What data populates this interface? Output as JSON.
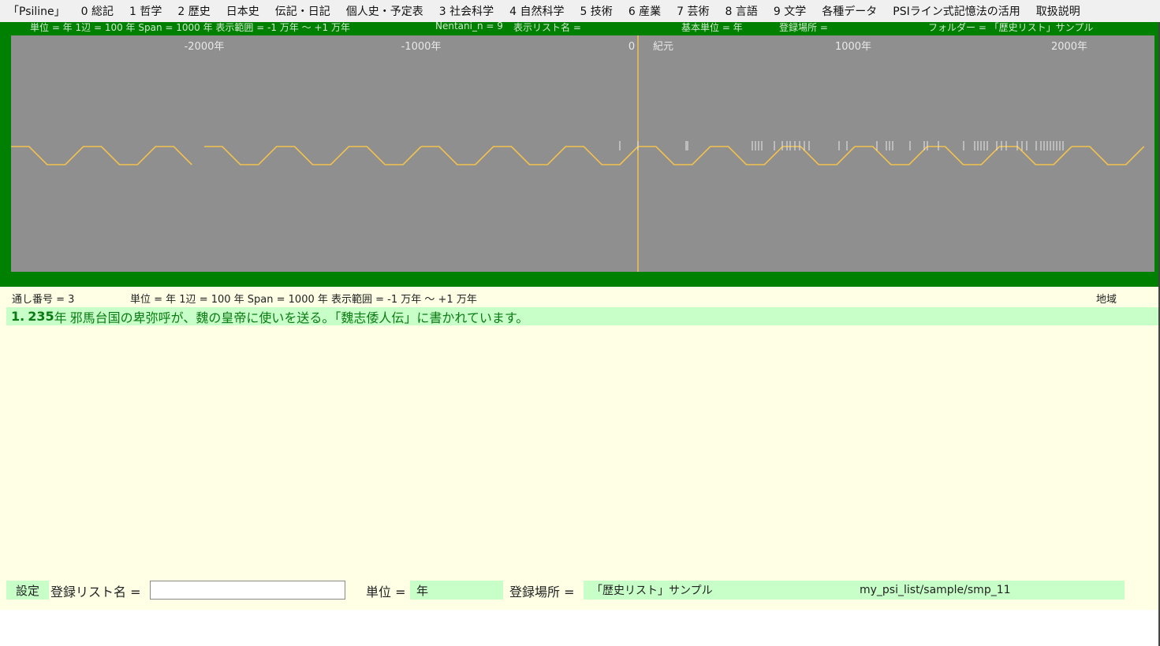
{
  "menu": [
    "「Psiline」",
    "0 総記",
    "1 哲学",
    "2 歴史",
    "日本史",
    "伝記・日記",
    "個人史・予定表",
    "3 社会科学",
    "4 自然科学",
    "5 技術",
    "6 産業",
    "7 芸術",
    "8 言語",
    "9 文学",
    "各種データ",
    "PSIライン式記憶法の活用",
    "取扱説明"
  ],
  "timeline_header": {
    "unit_info": "単位 = 年  1辺 = 100 年  Span = 1000 年  表示範囲 = -1 万年 〜 +1 万年",
    "nentani": "Nentani_n = 9",
    "list_name": "表示リスト名 =",
    "base_unit": "基本単位 = 年",
    "location": "登録場所 =",
    "folder": "フォルダー = 「歴史リスト」サンプル"
  },
  "axis_labels": [
    "-2000年",
    "-1000年",
    "0",
    "紀元",
    "1000年",
    "2000年"
  ],
  "colors": {
    "timeline_bg": "#8f8f8f",
    "frame": "#008000",
    "line": "#f2c24e",
    "tick": "#e8e8e8",
    "panel": "#ffffe6",
    "highlight": "#c8ffc8"
  },
  "info_row": {
    "serial": "通し番号 = 3",
    "unit_info": "単位 = 年  1辺 = 100 年  Span = 1000 年  表示範囲 = -1 万年 〜 +1 万年",
    "region": "地域"
  },
  "event": {
    "number": "1.",
    "year": "235",
    "year_unit": "年",
    "text": "邪馬台国の卑弥呼が、魏の皇帝に使いを送る。「魏志倭人伝」に書かれています。"
  },
  "settings": {
    "settings_label": "設定",
    "list_name_label": "登録リスト名 =",
    "list_name_value": "",
    "unit_label": "単位 =",
    "unit_value": "年",
    "location_label": "登録場所 =",
    "location_value": "「歴史リスト」サンプル",
    "path": "my_psi_list/sample/smp_11"
  }
}
